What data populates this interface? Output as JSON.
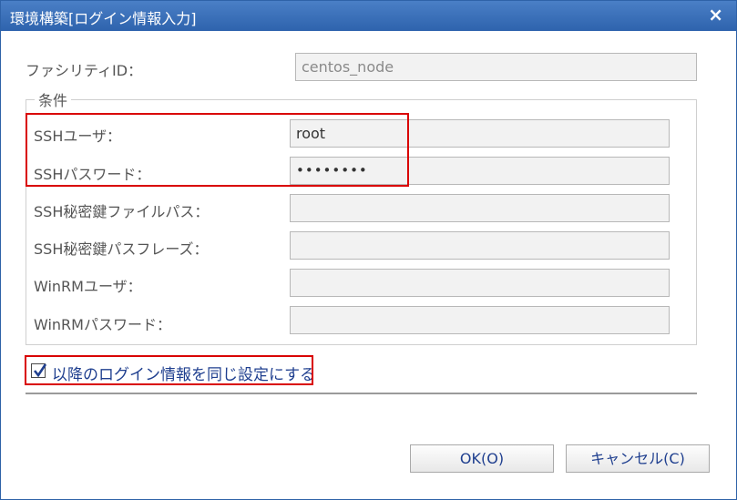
{
  "dialog": {
    "title": "環境構築[ログイン情報入力]",
    "close_label": "×"
  },
  "facility": {
    "label": "ファシリティID：",
    "value": "centos_node"
  },
  "conditions": {
    "legend": "条件",
    "ssh_user_label": "SSHユーザ：",
    "ssh_user_value": "root",
    "ssh_password_label": "SSHパスワード：",
    "ssh_password_value": "••••••••",
    "ssh_key_path_label": "SSH秘密鍵ファイルパス：",
    "ssh_key_path_value": "",
    "ssh_passphrase_label": "SSH秘密鍵パスフレーズ：",
    "ssh_passphrase_value": "",
    "winrm_user_label": "WinRMユーザ：",
    "winrm_user_value": "",
    "winrm_password_label": "WinRMパスワード：",
    "winrm_password_value": ""
  },
  "same_settings": {
    "label": "以降のログイン情報を同じ設定にする",
    "checked": true
  },
  "buttons": {
    "ok": "OK(O)",
    "cancel": "キャンセル(C)"
  },
  "colors": {
    "titlebar": "#2e63ad",
    "highlight": "#d90000",
    "link_text": "#1f3f8f"
  }
}
